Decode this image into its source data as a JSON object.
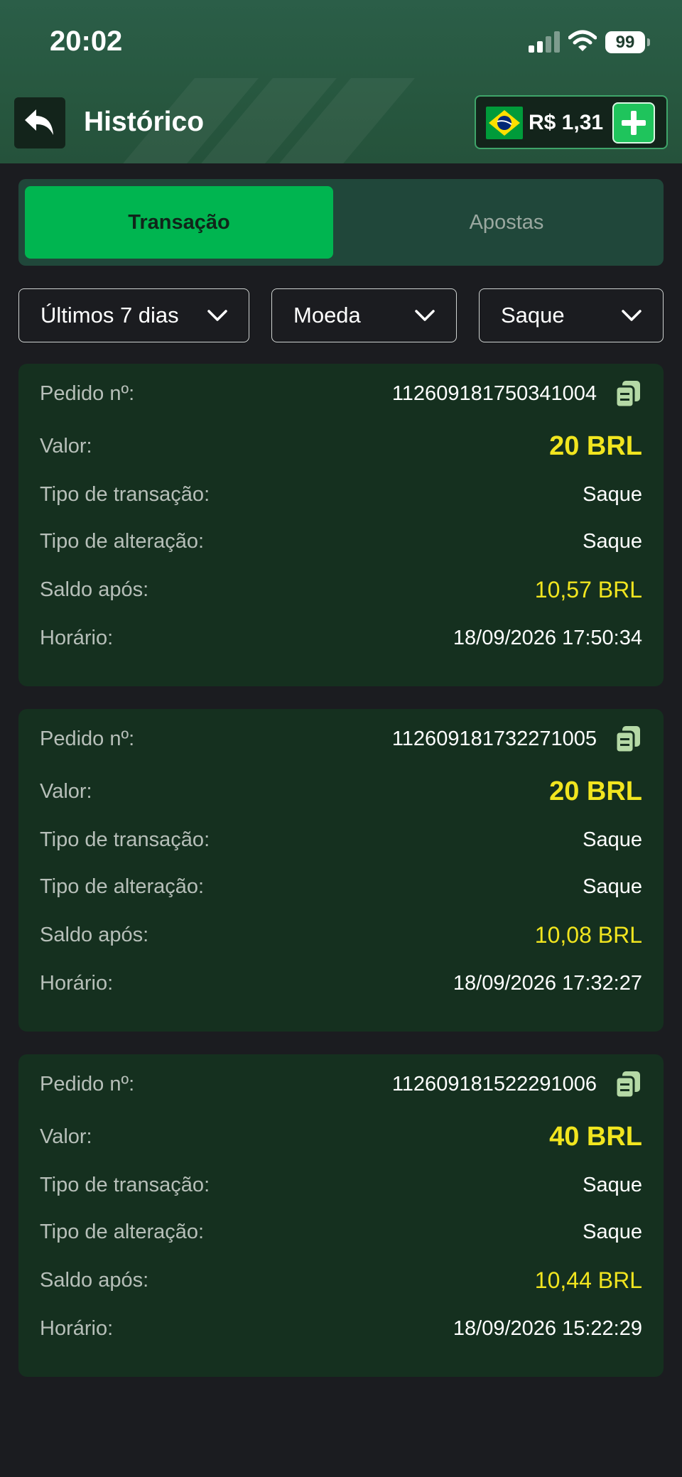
{
  "status_bar": {
    "time": "20:02",
    "battery": "99"
  },
  "header": {
    "title": "Histórico",
    "balance": "R$ 1,31"
  },
  "tabs": [
    {
      "label": "Transação",
      "active": true
    },
    {
      "label": "Apostas",
      "active": false
    }
  ],
  "filters": [
    {
      "label": "Últimos 7 dias"
    },
    {
      "label": "Moeda"
    },
    {
      "label": "Saque"
    }
  ],
  "field_labels": {
    "order": "Pedido nº:",
    "value": "Valor:",
    "transaction_type": "Tipo de transação:",
    "change_type": "Tipo de alteração:",
    "balance_after": "Saldo após:",
    "time": "Horário:"
  },
  "transactions": [
    {
      "order": "112609181750341004",
      "value": "20 BRL",
      "transaction_type": "Saque",
      "change_type": "Saque",
      "balance_after": "10,57 BRL",
      "time": "18/09/2026 17:50:34"
    },
    {
      "order": "112609181732271005",
      "value": "20 BRL",
      "transaction_type": "Saque",
      "change_type": "Saque",
      "balance_after": "10,08 BRL",
      "time": "18/09/2026 17:32:27"
    },
    {
      "order": "112609181522291006",
      "value": "40 BRL",
      "transaction_type": "Saque",
      "change_type": "Saque",
      "balance_after": "10,44 BRL",
      "time": "18/09/2026 15:22:29"
    }
  ],
  "colors": {
    "accent_green": "#00b550",
    "amount_yellow": "#f1e51f",
    "card_bg": "#15301f",
    "page_bg": "#1b1c20"
  }
}
